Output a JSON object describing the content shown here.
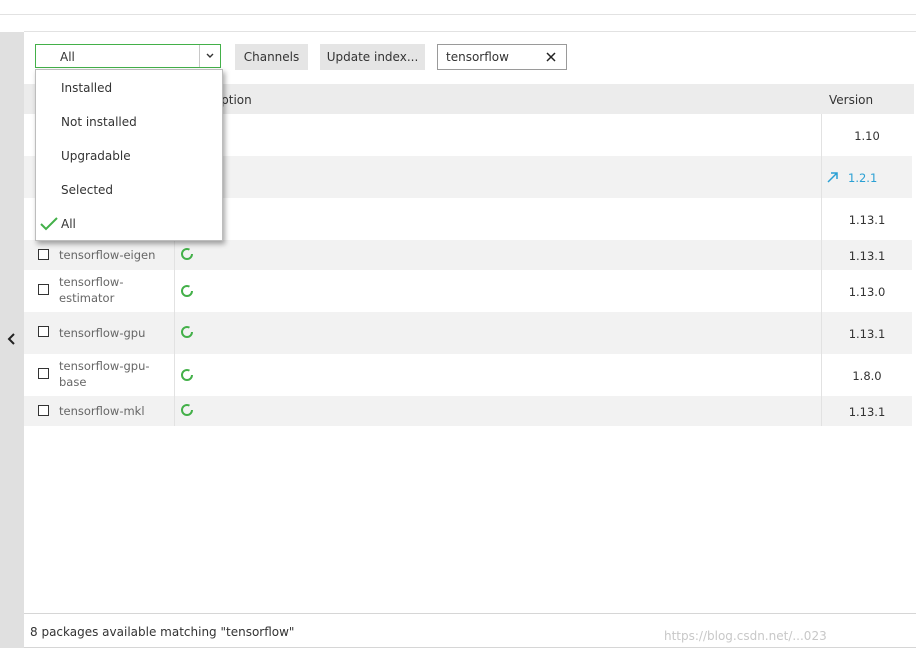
{
  "toolbar": {
    "filter_value": "All",
    "channels_label": "Channels",
    "update_index_label": "Update index...",
    "search_value": "tensorflow"
  },
  "filter_menu": {
    "items": [
      {
        "label": "Installed",
        "checked": false
      },
      {
        "label": "Not installed",
        "checked": false
      },
      {
        "label": "Upgradable",
        "checked": false
      },
      {
        "label": "Selected",
        "checked": false
      },
      {
        "label": "All",
        "checked": true
      }
    ]
  },
  "table": {
    "columns": {
      "description": "Description",
      "description_visible": "scription",
      "version": "Version"
    },
    "rows": [
      {
        "name": "",
        "version": "1.10",
        "upgradable": false,
        "hidden": true
      },
      {
        "name": "",
        "version": "1.2.1",
        "upgradable": true,
        "hidden": true
      },
      {
        "name": "",
        "version": "1.13.1",
        "upgradable": false,
        "hidden": true
      },
      {
        "name": "tensorflow-eigen",
        "version": "1.13.1",
        "upgradable": false
      },
      {
        "name": "tensorflow-estimator",
        "name_lines": [
          "tensorflow-",
          "estimator"
        ],
        "version": "1.13.0",
        "upgradable": false
      },
      {
        "name": "tensorflow-gpu",
        "version": "1.13.1",
        "upgradable": false
      },
      {
        "name": "tensorflow-gpu-base",
        "name_lines": [
          "tensorflow-gpu-",
          "base"
        ],
        "version": "1.8.0",
        "upgradable": false
      },
      {
        "name": "tensorflow-mkl",
        "version": "1.13.1",
        "upgradable": false
      }
    ]
  },
  "status": {
    "text": "8 packages available matching \"tensorflow\""
  },
  "watermark": "https://blog.csdn.net/...023",
  "colors": {
    "accent_green": "#43b049",
    "upgrade_blue": "#2aa0d4",
    "row_alt": "#f2f2f2"
  }
}
